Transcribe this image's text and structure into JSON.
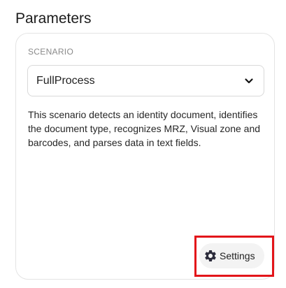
{
  "section": {
    "title": "Parameters"
  },
  "scenario": {
    "label": "SCENARIO",
    "selected": "FullProcess",
    "description": "This scenario detects an identity document, identifies the document type, recognizes MRZ, Visual zone and barcodes, and parses data in text fields."
  },
  "settings_button": {
    "label": "Settings",
    "icon": "gear-icon"
  },
  "colors": {
    "highlight": "#e3151a",
    "button_bg": "#f3f3f3",
    "card_border": "#e4e4e4"
  }
}
